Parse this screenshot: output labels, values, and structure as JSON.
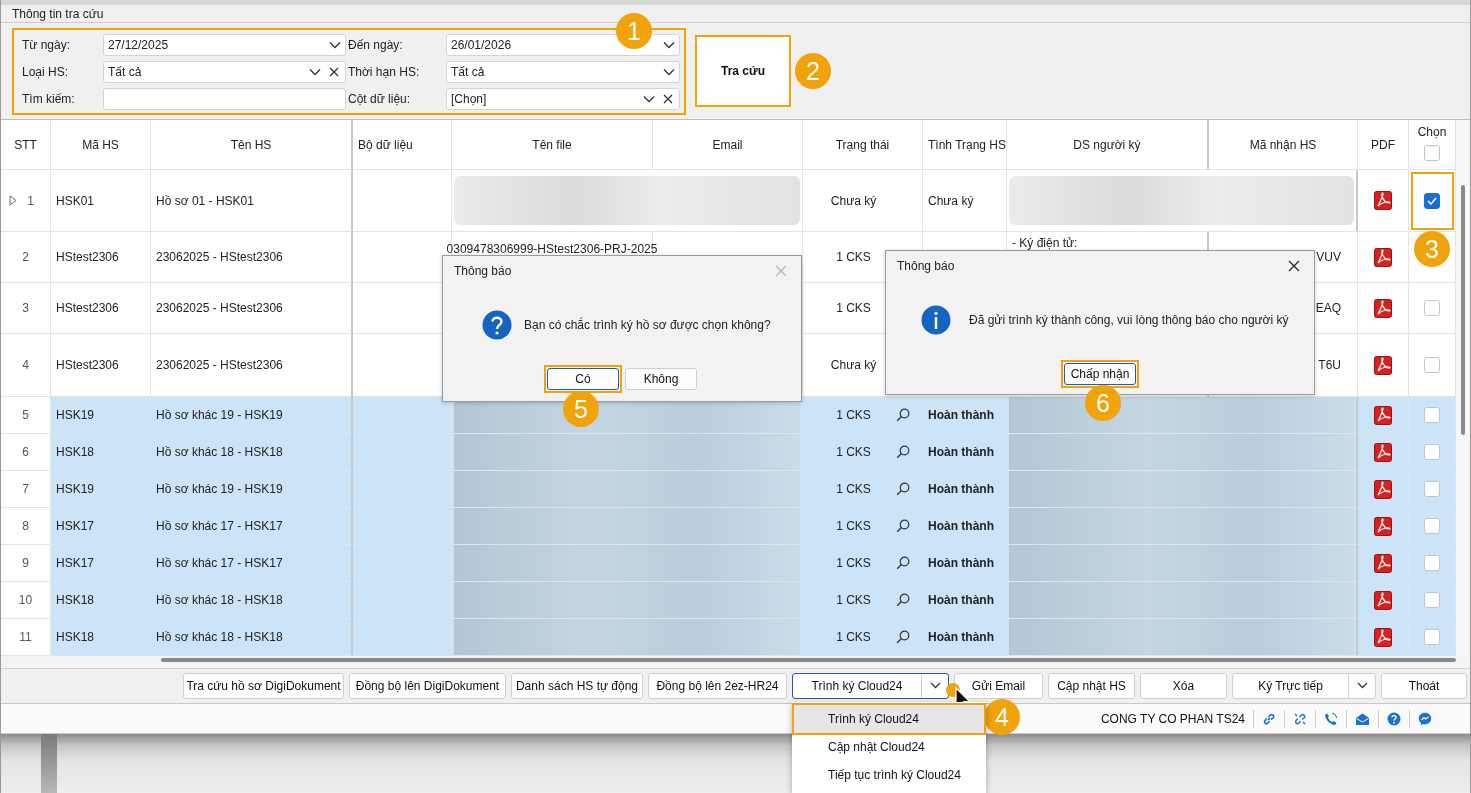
{
  "panel": {
    "title": "Thông tin tra cứu",
    "highlighted": true,
    "fields": [
      {
        "label": "Từ ngày:",
        "value": "27/12/2025",
        "kind": "combo",
        "clearable": false
      },
      {
        "label": "Đến ngày:",
        "value": "26/01/2026",
        "kind": "combo",
        "clearable": false
      },
      {
        "label": "Loại HS:",
        "value": "Tất cả",
        "kind": "combo",
        "clearable": true
      },
      {
        "label": "Thời hạn HS:",
        "value": "Tất cả",
        "kind": "combo",
        "clearable": false
      },
      {
        "label": "Tìm kiếm:",
        "kind": "text"
      },
      {
        "label": "Cột dữ liệu:",
        "value": "[Chọn]",
        "kind": "combo",
        "clearable": true
      }
    ]
  },
  "search_button": {
    "label": "Tra cứu",
    "highlighted": true
  },
  "table": {
    "columns": [
      "STT",
      "Mã HS",
      "Tên HS",
      "Bộ dữ liệu",
      "Tên file",
      "Email",
      "Trạng thái",
      "Tình Trạng HS",
      "DS người ký",
      "Mã nhận HS",
      "PDF",
      "Chọn"
    ],
    "select_all_checked": false,
    "rows": [
      {
        "stt": "1",
        "current": true,
        "selected": false,
        "blurred": true,
        "ma_hs": "HSK01",
        "ten_hs": "Hồ sơ 01 - HSK01",
        "trang_thai": "Chưa ký",
        "search_icon": false,
        "tinh_trang": "Chưa ký",
        "checked": true,
        "highlighted": true
      },
      {
        "stt": "2",
        "current": false,
        "selected": false,
        "blurred": false,
        "ma_hs": "HStest2306",
        "ten_hs": "23062025 - HStest2306",
        "ten_file": "0309478306999-HStest2306-PRJ-2025",
        "trang_thai": "1 CKS",
        "ds_nguoi_ky": "- Ký điện tử:",
        "ma_nhan": "VUV",
        "highlighted": false
      },
      {
        "stt": "3",
        "current": false,
        "selected": false,
        "blurred": false,
        "ma_hs": "HStest2306",
        "ten_hs": "23062025 - HStest2306",
        "trang_thai": "1 CKS",
        "ma_nhan": "EAQ",
        "checked": false,
        "highlighted": false
      },
      {
        "stt": "4",
        "current": false,
        "selected": false,
        "blurred": false,
        "ma_hs": "HStest2306",
        "ten_hs": "23062025 - HStest2306",
        "trang_thai": "Chưa ký",
        "ma_nhan": "T6U",
        "checked": false,
        "highlighted": false
      },
      {
        "stt": "5",
        "current": false,
        "selected": true,
        "blurred": true,
        "ma_hs": "HSK19",
        "ten_hs": "Hồ sơ khác 19 - HSK19",
        "trang_thai": "1 CKS",
        "search_icon": true,
        "tinh_trang": "Hoàn thành",
        "checked": false,
        "highlighted": false
      },
      {
        "stt": "6",
        "current": false,
        "selected": true,
        "blurred": true,
        "ma_hs": "HSK18",
        "ten_hs": "Hồ sơ khác 18 - HSK18",
        "trang_thai": "1 CKS",
        "search_icon": true,
        "tinh_trang": "Hoàn thành",
        "checked": false,
        "highlighted": false
      },
      {
        "stt": "7",
        "current": false,
        "selected": true,
        "blurred": true,
        "ma_hs": "HSK19",
        "ten_hs": "Hồ sơ khác 19 - HSK19",
        "trang_thai": "1 CKS",
        "search_icon": true,
        "tinh_trang": "Hoàn thành",
        "checked": false,
        "highlighted": false
      },
      {
        "stt": "8",
        "current": false,
        "selected": true,
        "blurred": true,
        "ma_hs": "HSK17",
        "ten_hs": "Hồ sơ khác 17 - HSK17",
        "trang_thai": "1 CKS",
        "search_icon": true,
        "tinh_trang": "Hoàn thành",
        "checked": false,
        "highlighted": false
      },
      {
        "stt": "9",
        "current": false,
        "selected": true,
        "blurred": true,
        "ma_hs": "HSK17",
        "ten_hs": "Hồ sơ khác 17 - HSK17",
        "trang_thai": "1 CKS",
        "search_icon": true,
        "tinh_trang": "Hoàn thành",
        "checked": false,
        "highlighted": false
      },
      {
        "stt": "10",
        "current": false,
        "selected": true,
        "blurred": true,
        "ma_hs": "HSK18",
        "ten_hs": "Hồ sơ khác 18 - HSK18",
        "trang_thai": "1 CKS",
        "search_icon": true,
        "tinh_trang": "Hoàn thành",
        "checked": false,
        "highlighted": false
      },
      {
        "stt": "11",
        "current": false,
        "selected": true,
        "blurred": true,
        "ma_hs": "HSK18",
        "ten_hs": "Hồ sơ khác 18 - HSK18",
        "trang_thai": "1 CKS",
        "search_icon": true,
        "tinh_trang": "Hoàn thành",
        "checked": false,
        "highlighted": false
      }
    ]
  },
  "dialogs": [
    {
      "title": "Thông báo",
      "kind": "confirm",
      "message": "Bạn có chắc trình ký hồ sơ được chọn không?",
      "close_enabled": false,
      "buttons": [
        {
          "label": "Có",
          "focused": true,
          "highlighted": true
        },
        {
          "label": "Không",
          "focused": false,
          "highlighted": false
        }
      ]
    },
    {
      "title": "Thông báo",
      "kind": "info",
      "message": "Đã gửi trình ký thành công, vui lòng thông báo cho người ký",
      "close_enabled": true,
      "buttons": [
        {
          "label": "Chấp nhận",
          "focused": true,
          "highlighted": true
        }
      ]
    }
  ],
  "toolbar": [
    {
      "label": "Tra cứu hồ sơ DigiDokument",
      "kind": "button",
      "focused": false
    },
    {
      "label": "Đồng bộ lên DigiDokument",
      "kind": "button",
      "focused": false
    },
    {
      "label": "Danh sách HS tự động",
      "kind": "button",
      "focused": false
    },
    {
      "label": "Đồng bộ lên 2ez-HR24",
      "kind": "button",
      "focused": false
    },
    {
      "label": "Trình ký Cloud24",
      "kind": "split",
      "focused": true,
      "menu": [
        {
          "label": "Trình ký Cloud24",
          "selected": true,
          "highlighted": true
        },
        {
          "label": "Cập nhật Cloud24",
          "selected": false,
          "highlighted": false
        },
        {
          "label": "Tiếp tục trình ký Cloud24",
          "selected": false,
          "highlighted": false
        }
      ]
    },
    {
      "label": "Gửi Email",
      "kind": "button",
      "focused": false
    },
    {
      "label": "Cập nhật HS",
      "kind": "button",
      "focused": false
    },
    {
      "label": "Xóa",
      "kind": "button",
      "focused": false
    },
    {
      "label": "Ký Trực tiếp",
      "kind": "split",
      "focused": false
    },
    {
      "label": "Thoát",
      "kind": "button",
      "focused": false
    }
  ],
  "status_bar": {
    "company": "CONG TY CO PHAN TS24"
  },
  "callouts": [
    "1",
    "2",
    "3",
    "4",
    "5",
    "6"
  ]
}
